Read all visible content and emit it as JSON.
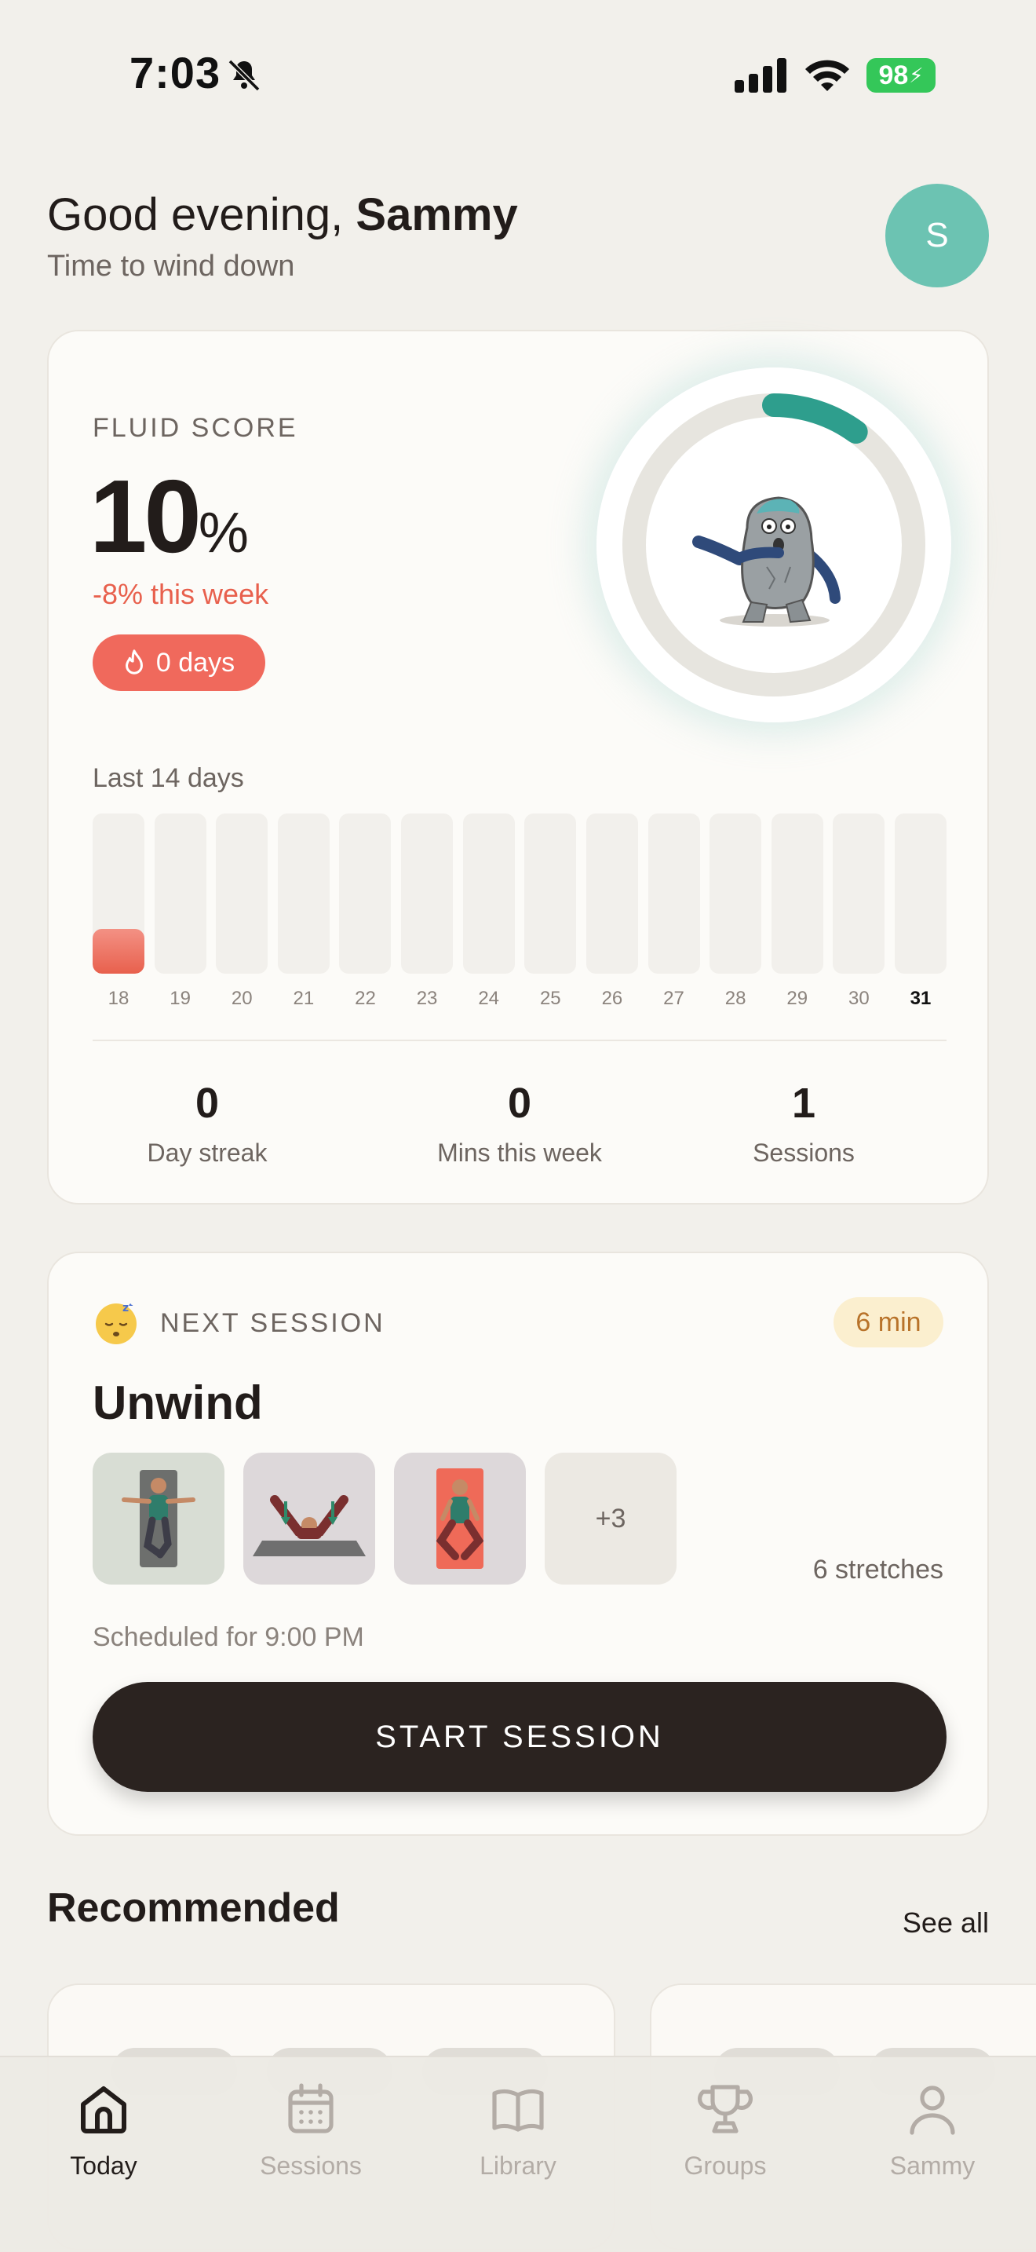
{
  "status_bar": {
    "time": "7:03",
    "battery": "98"
  },
  "header": {
    "greeting_prefix": "Good evening,",
    "user_name": "Sammy",
    "subtitle": "Time to wind down",
    "avatar_initial": "S"
  },
  "fluid_score": {
    "label": "FLUID SCORE",
    "value": "10",
    "unit": "%",
    "ring_fraction": 0.1,
    "delta": "-8% this week",
    "streak_pill": "0 days",
    "history_label": "Last 14 days",
    "days": [
      {
        "day": "18",
        "level": 0.28,
        "current": false
      },
      {
        "day": "19",
        "level": 0,
        "current": false
      },
      {
        "day": "20",
        "level": 0,
        "current": false
      },
      {
        "day": "21",
        "level": 0,
        "current": false
      },
      {
        "day": "22",
        "level": 0,
        "current": false
      },
      {
        "day": "23",
        "level": 0,
        "current": false
      },
      {
        "day": "24",
        "level": 0,
        "current": false
      },
      {
        "day": "25",
        "level": 0,
        "current": false
      },
      {
        "day": "26",
        "level": 0,
        "current": false
      },
      {
        "day": "27",
        "level": 0,
        "current": false
      },
      {
        "day": "28",
        "level": 0,
        "current": false
      },
      {
        "day": "29",
        "level": 0,
        "current": false
      },
      {
        "day": "30",
        "level": 0,
        "current": false
      },
      {
        "day": "31",
        "level": 0,
        "current": true
      }
    ],
    "stats": [
      {
        "value": "0",
        "label": "Day streak"
      },
      {
        "value": "0",
        "label": "Mins this week"
      },
      {
        "value": "1",
        "label": "Sessions"
      }
    ]
  },
  "next_session": {
    "label": "NEXT SESSION",
    "duration": "6 min",
    "title": "Unwind",
    "more_count": "+3",
    "stretch_count": "6 stretches",
    "scheduled": "Scheduled for 9:00 PM",
    "start_label": "START SESSION"
  },
  "recommended": {
    "title": "Recommended",
    "see_all": "See all"
  },
  "tabs": [
    {
      "label": "Today",
      "icon": "home-icon",
      "active": true
    },
    {
      "label": "Sessions",
      "icon": "calendar-icon",
      "active": false
    },
    {
      "label": "Library",
      "icon": "book-icon",
      "active": false
    },
    {
      "label": "Groups",
      "icon": "trophy-icon",
      "active": false
    },
    {
      "label": "Sammy",
      "icon": "person-icon",
      "active": false
    }
  ],
  "colors": {
    "accent_teal": "#2e9e8d",
    "avatar_teal": "#6cc3b2",
    "alert_red": "#e8604d",
    "dark_button": "#2b2320"
  }
}
